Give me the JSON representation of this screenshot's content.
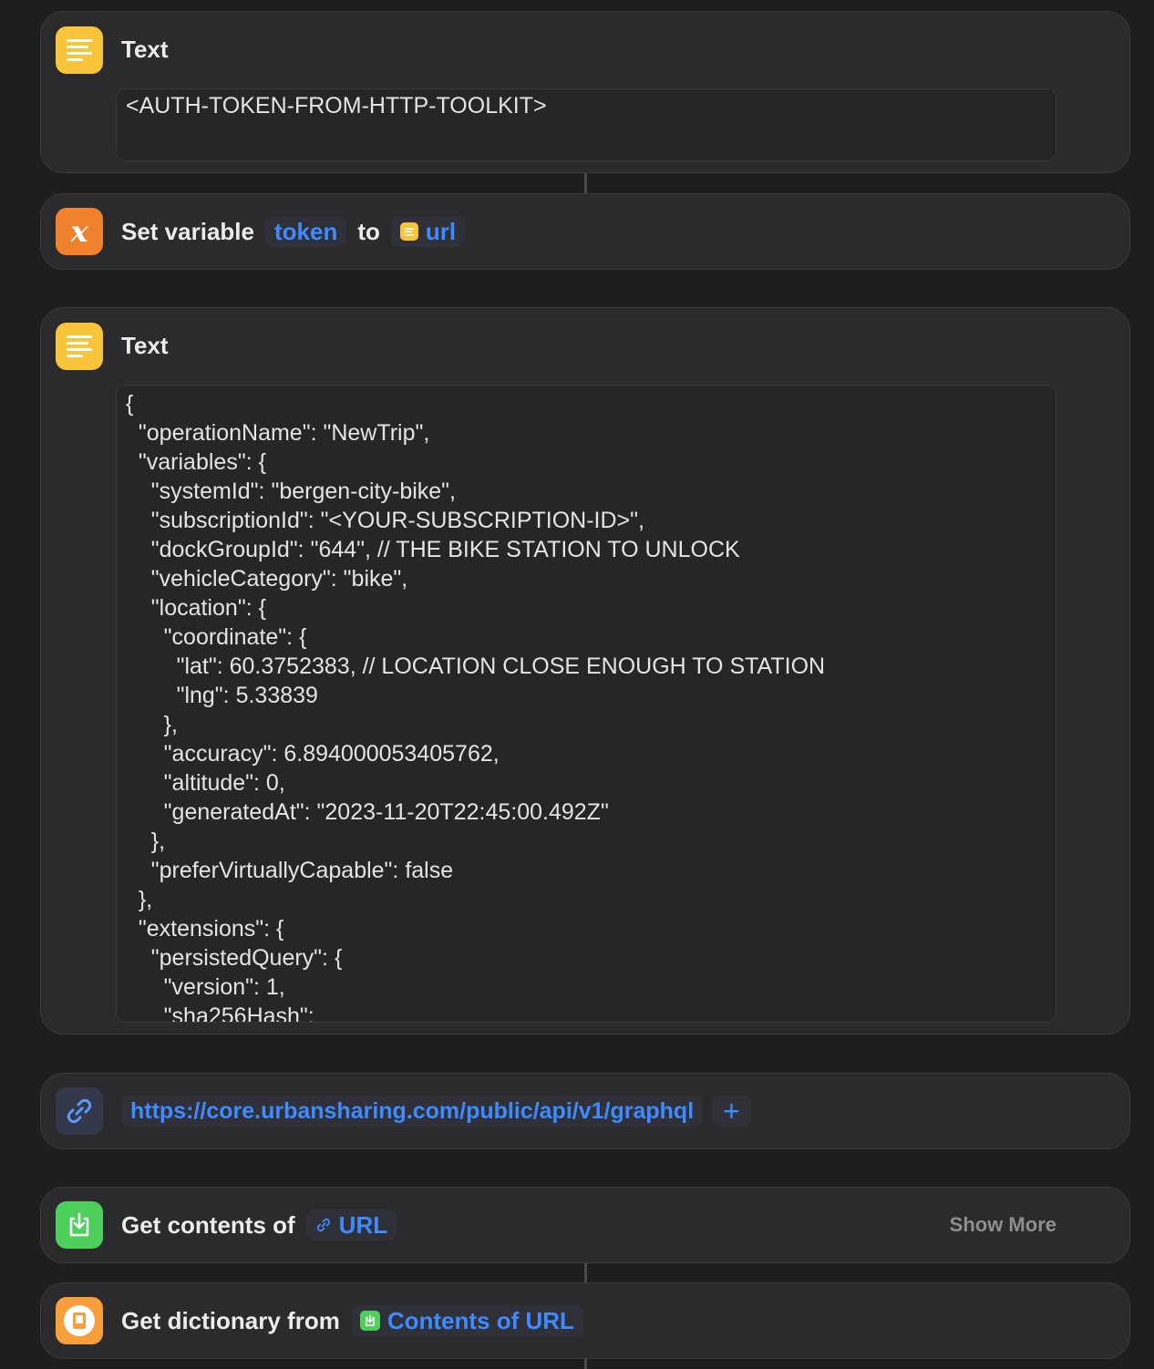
{
  "text_action_1": {
    "title": "Text",
    "content": "<AUTH-TOKEN-FROM-HTTP-TOOLKIT>"
  },
  "set_variable": {
    "label": "Set variable",
    "variable_name": "token",
    "to_label": "to",
    "value_label": "url"
  },
  "text_action_2": {
    "title": "Text",
    "content": "{\n  \"operationName\": \"NewTrip\",\n  \"variables\": {\n    \"systemId\": \"bergen-city-bike\",\n    \"subscriptionId\": \"<YOUR-SUBSCRIPTION-ID>\",\n    \"dockGroupId\": \"644\", // THE BIKE STATION TO UNLOCK\n    \"vehicleCategory\": \"bike\",\n    \"location\": {\n      \"coordinate\": {\n        \"lat\": 60.3752383, // LOCATION CLOSE ENOUGH TO STATION\n        \"lng\": 5.33839\n      },\n      \"accuracy\": 6.894000053405762,\n      \"altitude\": 0,\n      \"generatedAt\": \"2023-11-20T22:45:00.492Z\"\n    },\n    \"preferVirtuallyCapable\": false\n  },\n  \"extensions\": {\n    \"persistedQuery\": {\n      \"version\": 1,\n      \"sha256Hash\":"
  },
  "url_action": {
    "url": "https://core.urbansharing.com/public/api/v1/graphql",
    "add_label": "+"
  },
  "get_contents": {
    "label": "Get contents of",
    "input_label": "URL",
    "show_more_label": "Show More"
  },
  "get_dictionary": {
    "label": "Get dictionary from",
    "input_label": "Contents of URL"
  },
  "colors": {
    "text_icon": "#f8c53a",
    "variable_icon": "#f0812d",
    "url_icon_bg": "#33384a",
    "link_blue": "#3d8bff",
    "get_contents_icon": "#4ccf5b",
    "dictionary_icon": "#f5a03a"
  },
  "icons": [
    "text-lines-icon",
    "variable-x-icon",
    "link-icon",
    "download-tray-icon",
    "dictionary-book-icon"
  ]
}
